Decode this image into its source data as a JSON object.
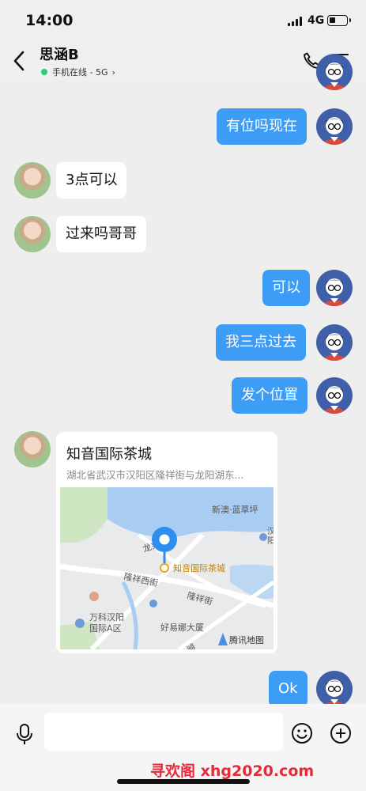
{
  "status_bar": {
    "time": "14:00",
    "network": "4G",
    "signal_bars": 4,
    "battery_level": 0.3
  },
  "header": {
    "back_icon": "chevron-left-icon",
    "title": "思涵B",
    "status": "手机在线 - 5G",
    "status_color": "#2ecc71",
    "phone_icon": "phone-icon",
    "menu_icon": "menu-icon"
  },
  "messages": [
    {
      "side": "out",
      "text": "有位吗现在"
    },
    {
      "side": "in",
      "text": "3点可以"
    },
    {
      "side": "in",
      "text": "过来吗哥哥"
    },
    {
      "side": "out",
      "text": "可以"
    },
    {
      "side": "out",
      "text": "我三点过去"
    },
    {
      "side": "out",
      "text": "发个位置"
    },
    {
      "side": "out",
      "text": "Ok"
    }
  ],
  "location": {
    "name": "知音国际茶城",
    "address": "湖北省武汉市汉阳区隆祥街与龙阳湖东...",
    "map_labels": {
      "poi_ne": "新澳·蓝草坪",
      "road_north": "龙兴西街",
      "marker_label": "知音国际茶城",
      "road_west": "隆祥西街",
      "road_east": "隆祥街",
      "poi_sw_1": "万科汉阳",
      "poi_sw_2": "国际A区",
      "poi_south": "好易娜大厦",
      "attribution": "腾讯地图",
      "edge_1": "汉",
      "edge_2": "阳",
      "edge_3": "堂"
    }
  },
  "input_bar": {
    "placeholder": "",
    "mic_icon": "microphone-icon",
    "emoji_icon": "emoji-icon",
    "plus_icon": "plus-icon"
  },
  "watermark": "寻欢阁 xhg2020.com",
  "colors": {
    "outgoing_bubble": "#3d9cf5",
    "incoming_bubble": "#ffffff",
    "background": "#eeeeee",
    "watermark": "#e8293a"
  }
}
